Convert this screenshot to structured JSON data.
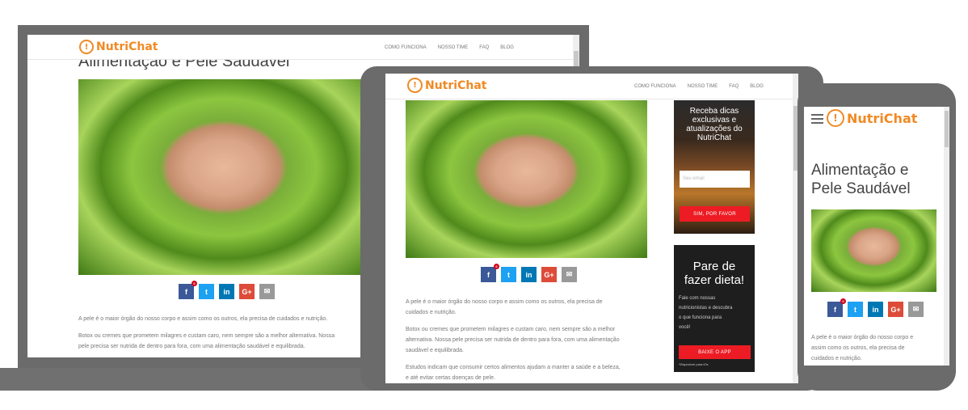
{
  "brand": "NutriChat",
  "nav": {
    "items": [
      "COMO FUNCIONA",
      "NOSSO TIME",
      "FAQ",
      "BLOG"
    ]
  },
  "article": {
    "title": "Alimentação e Pele Saudável",
    "title_line1": "Alimentação e",
    "title_line2": "Pele Saudável",
    "share_count": "0",
    "desktop_p1": "A pele é o maior órgão do nosso corpo e assim como os outros, ela precisa de cuidados e nutrição.",
    "desktop_p2a": "Botox ou cremes que prometem milagres e custam caro, nem sempre são a melhor alternativa. Nossa",
    "desktop_p2b": "pele precisa ser nutrida de dentro para fora, com uma alimentação saudável e equilibrada.",
    "tablet_p1a": "A pele é o maior órgão do nosso corpo e assim como os outros, ela precisa de",
    "tablet_p1b": "cuidados e nutrição.",
    "tablet_p2a": "Botox ou cremes que prometem milagres e custam caro, nem sempre são a melhor",
    "tablet_p2b": "alternativa. Nossa pele precisa ser nutrida de dentro para fora, com uma alimentação",
    "tablet_p2c": "saudável e equilibrada.",
    "tablet_p3a": "Estudos indicam que consumir certos alimentos ajudam a manter a saúde e a beleza,",
    "tablet_p3b": "e até evitar certas doenças de pele.",
    "mobile_p1a": "A pele é o maior órgão do nosso corpo e",
    "mobile_p1b": "assim como os outros, ela precisa de",
    "mobile_p1c": "cuidados e nutrição."
  },
  "newsletter": {
    "l1": "Receba dicas",
    "l2": "exclusivas e",
    "l3": "atualizações do",
    "l4": "NutriChat",
    "placeholder": "Seu email",
    "button": "SIM, POR FAVOR"
  },
  "app": {
    "l1": "Pare de",
    "l2": "fazer dieta!",
    "d1": "Fale com nossas",
    "d2": "nutricionistas e descubra",
    "d3": "o que funciona para",
    "d4": "você!",
    "button": "BAIXE O APP",
    "note": "*Disponível para iOs"
  },
  "colors": {
    "brand": "#f08a24",
    "red": "#ed1c24",
    "frame": "#6b6b6b"
  }
}
